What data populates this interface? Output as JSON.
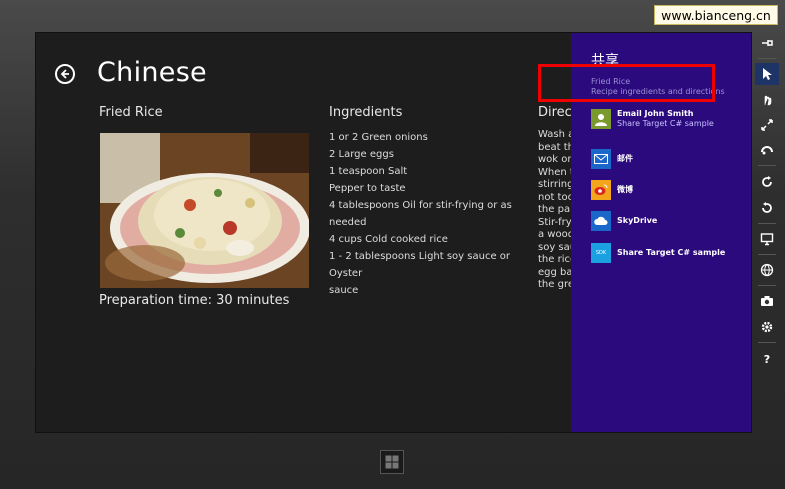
{
  "watermark": "www.bianceng.cn",
  "app": {
    "title": "Chinese",
    "back_icon": "back-arrow-icon"
  },
  "recipe": {
    "title": "Fried Rice",
    "preparation": "Preparation time: 30 minutes",
    "ingredients_heading": "Ingredients",
    "ingredients": [
      "1 or 2 Green onions",
      "2 Large eggs",
      "1 teaspoon Salt",
      "Pepper to taste",
      "4 tablespoons Oil for stir-frying or as",
      "needed",
      "4 cups Cold cooked rice",
      "1 - 2 tablespoons Light soy sauce or Oyster",
      "sauce"
    ],
    "directions_heading": "Directions",
    "directions_lines": [
      "Wash and",
      "beat the",
      "wok or",
      "When th",
      "stirring,",
      "not too",
      "the pan",
      "Stir-fry",
      "a wood",
      "soy sau",
      "the rice",
      "egg bac",
      "the gree"
    ]
  },
  "share": {
    "title": "共享",
    "subtitle_1": "Fried Rice",
    "subtitle_2": "Recipe ingredients and directions",
    "targets": [
      {
        "name": "Email John Smith",
        "desc": "Share Target C# sample",
        "icon": "contact-icon",
        "color": "#7a9a2e"
      },
      {
        "name": "邮件",
        "desc": "",
        "icon": "mail-icon",
        "color": "#1a66c9"
      },
      {
        "name": "微博",
        "desc": "",
        "icon": "weibo-icon",
        "color": "#f3a51c"
      },
      {
        "name": "SkyDrive",
        "desc": "",
        "icon": "cloud-icon",
        "color": "#1a66c9"
      },
      {
        "name": "Share Target C# sample",
        "desc": "",
        "icon": "sdk-icon",
        "color": "#1ba1e2",
        "tile_text": "SDK"
      }
    ]
  },
  "colors": {
    "screen_bg": "#1d1d1d",
    "share_bg": "#2a0a7c",
    "highlight": "#e00000"
  },
  "toolbar": {
    "tools": [
      "pin-icon",
      "mouse-pointer-icon",
      "touch-icon",
      "pinch-zoom-icon",
      "rotate-touch-icon",
      "rotate-clockwise-icon",
      "rotate-counterclockwise-icon",
      "resolution-icon",
      "location-icon",
      "screenshot-icon",
      "settings-icon",
      "help-icon"
    ],
    "help_label": "?"
  }
}
